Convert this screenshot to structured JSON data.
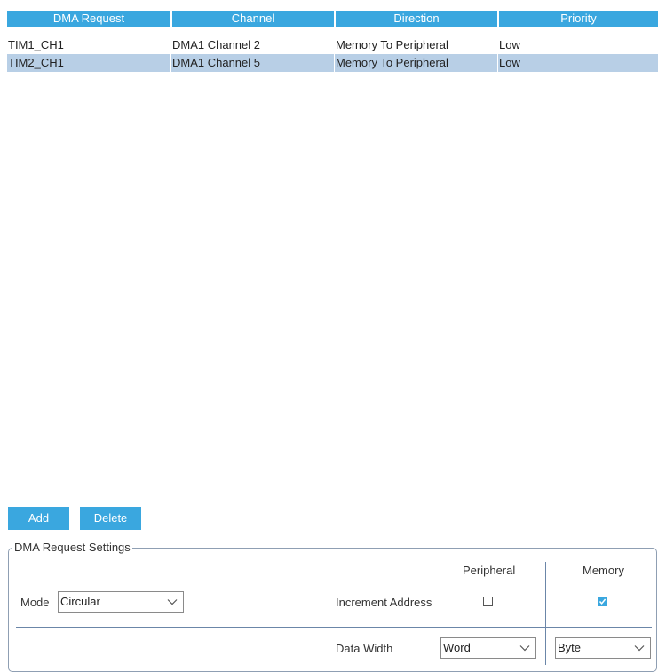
{
  "table": {
    "columns": [
      "DMA Request",
      "Channel",
      "Direction",
      "Priority"
    ],
    "rows": [
      {
        "request": "TIM1_CH1",
        "channel": "DMA1 Channel 2",
        "direction": "Memory To Peripheral",
        "priority": "Low",
        "selected": false
      },
      {
        "request": "TIM2_CH1",
        "channel": "DMA1 Channel 5",
        "direction": "Memory To Peripheral",
        "priority": "Low",
        "selected": true
      }
    ]
  },
  "buttons": {
    "add": "Add",
    "delete": "Delete"
  },
  "settings": {
    "legend": "DMA Request Settings",
    "peripheral_header": "Peripheral",
    "memory_header": "Memory",
    "mode_label": "Mode",
    "mode_value": "Circular",
    "increment_label": "Increment Address",
    "peripheral_increment_checked": false,
    "memory_increment_checked": true,
    "data_width_label": "Data Width",
    "peripheral_data_width": "Word",
    "memory_data_width": "Byte"
  },
  "colors": {
    "accent": "#3aa7df",
    "selected_row": "#b8cfe6",
    "divider": "#6b86a8"
  }
}
